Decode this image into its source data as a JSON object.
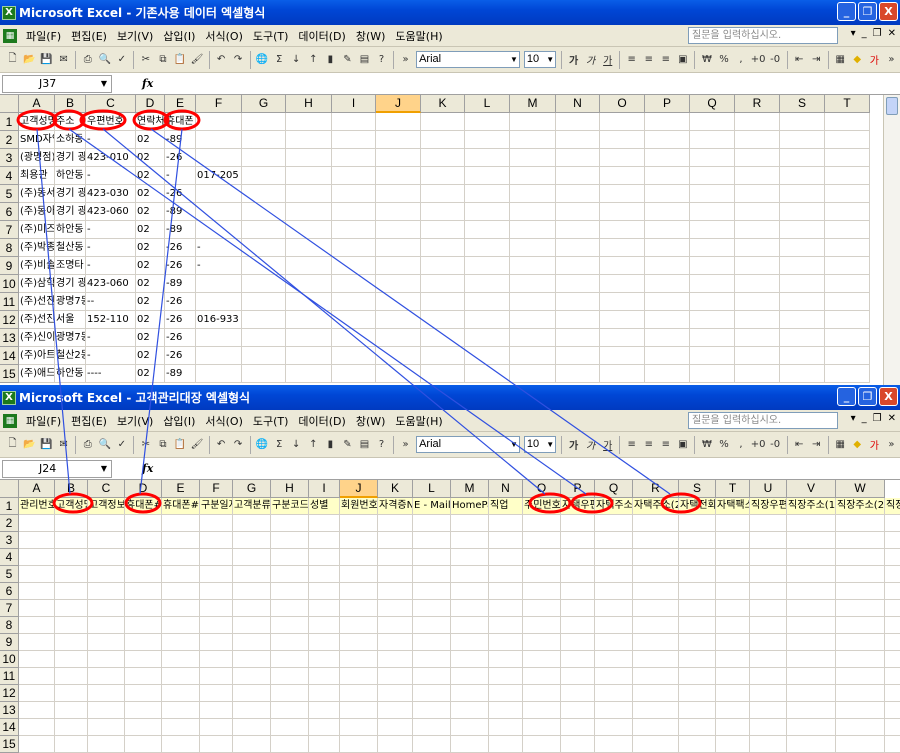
{
  "menus": [
    "파일(F)",
    "편집(E)",
    "보기(V)",
    "삽입(I)",
    "서식(O)",
    "도구(T)",
    "데이터(D)",
    "창(W)",
    "도움말(H)"
  ],
  "ask_placeholder": "질문을 입력하십시오.",
  "font_name": "Arial",
  "font_size": "10",
  "fx_label": "fx",
  "win1": {
    "title": "Microsoft Excel - 기존사용 데이터 엑셀형식",
    "name_box": "J37",
    "selected_col": "J",
    "columns": [
      "A",
      "B",
      "C",
      "D",
      "E",
      "F",
      "G",
      "H",
      "I",
      "J",
      "K",
      "L",
      "M",
      "N",
      "O",
      "P",
      "Q",
      "R",
      "S",
      "T"
    ],
    "rows": [
      "1",
      "2",
      "3",
      "4",
      "5",
      "6",
      "7",
      "8",
      "9",
      "10",
      "11",
      "12",
      "13",
      "14",
      "15"
    ],
    "data": [
      [
        "고객성명",
        "주소",
        "우편번호",
        "연락처",
        "휴대폰"
      ],
      [
        "SMD자인",
        "소하동",
        "-",
        "02",
        "-89",
        ""
      ],
      [
        "(광명점)",
        "경기 광",
        "423-010",
        "02",
        "-26",
        ""
      ],
      [
        "최용관",
        "하안동",
        "-",
        "02",
        "-",
        "017-205"
      ],
      [
        "(주)동서",
        "경기 광",
        "423-030",
        "02",
        "-26",
        ""
      ],
      [
        "(주)동아",
        "경기 광",
        "423-060",
        "02",
        "-89",
        ""
      ],
      [
        "(주)미즈",
        "하안동",
        "-",
        "02",
        "-89",
        ""
      ],
      [
        "(주)박종",
        "철산동",
        "-",
        "02",
        "-26",
        "-"
      ],
      [
        "(주)비솔",
        "조명타",
        "-",
        "02",
        "-26",
        "-"
      ],
      [
        "(주)삼학",
        "경기 광",
        "423-060",
        "02",
        "-89",
        ""
      ],
      [
        "(주)선진",
        "광명7동",
        "--",
        "02",
        "-26",
        ""
      ],
      [
        "(주)선진",
        "서울",
        "152-110",
        "02",
        "-26",
        "016-933"
      ],
      [
        "(주)신이",
        "광명7동",
        "-",
        "02",
        "-26",
        ""
      ],
      [
        "(주)아트",
        "철산2동",
        "-",
        "02",
        "-26",
        ""
      ],
      [
        "(주)애드",
        "하안동",
        "----",
        "02",
        "-89",
        ""
      ]
    ]
  },
  "win2": {
    "title": "Microsoft Excel - 고객관리대장 엑셀형식",
    "name_box": "J24",
    "selected_col": "J",
    "columns": [
      "A",
      "B",
      "C",
      "D",
      "E",
      "F",
      "G",
      "H",
      "I",
      "J",
      "K",
      "L",
      "M",
      "N",
      "O",
      "P",
      "Q",
      "R",
      "S",
      "T",
      "U",
      "V",
      "W"
    ],
    "rows": [
      "1",
      "2",
      "3",
      "4",
      "5",
      "6",
      "7",
      "8",
      "9",
      "10",
      "11",
      "12",
      "13",
      "14",
      "15"
    ],
    "headers": [
      "관리번호",
      "고객성명",
      "고객정보",
      "휴대폰#1",
      "휴대폰#2",
      "구분일자",
      "고객분류",
      "구분코드",
      "성별",
      "회원번호",
      "자격증No",
      "E - Mail",
      "HomePage",
      "직업",
      "주민번호",
      "자택우편",
      "자택주소(1)",
      "자택주소(2)",
      "자택전화",
      "자택팩스",
      "직장우편",
      "직장주소(1)",
      "직장주소(2)",
      "직장"
    ]
  },
  "colors": {
    "title_blue": "#0046d5",
    "annotation_red": "#ff0000",
    "annotation_line": "#3050e0",
    "header_yellow": "#ffffc8",
    "selected_col": "#ffd38a"
  }
}
